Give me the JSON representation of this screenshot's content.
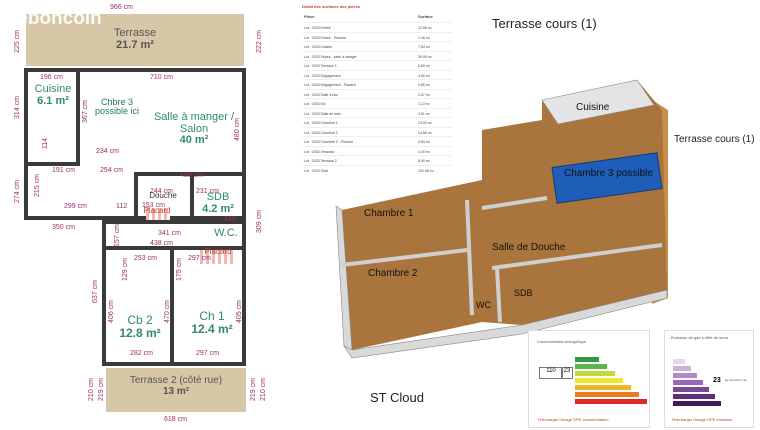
{
  "plan": {
    "watermark": "leboncoin",
    "terrace_top": {
      "name": "Terrasse",
      "area": "21.7 m²"
    },
    "terrace_bottom": {
      "name": "Terrasse 2 (côté rue)",
      "area": "13 m²"
    },
    "kitchen": {
      "name": "Cuisine",
      "area": "6.1 m²"
    },
    "chbre3": {
      "text": "Chbre 3 possible ici"
    },
    "living": {
      "name": "Salle à manger / Salon",
      "area": "40 m²"
    },
    "douche": {
      "name": "Douche",
      "area": "3 m²"
    },
    "sdb": {
      "name": "SDB",
      "area": "4.2 m²"
    },
    "placard1": {
      "name": "Placard",
      "area": "146"
    },
    "placard2": {
      "name": "Placard",
      "area": "179 cm"
    },
    "wc": {
      "name": "W.C."
    },
    "ch2": {
      "name": "Cb 2",
      "area": "12.8 m²"
    },
    "ch1": {
      "name": "Ch 1",
      "area": "12.4 m²"
    },
    "dims": {
      "top_width": "966 cm",
      "kitchen_w": "196 cm",
      "living_w": "710 cm",
      "d254": "254 cm",
      "d234": "234 cm",
      "d191": "191 cm",
      "d489": "489 cm",
      "d299": "299 cm",
      "d244": "244 cm",
      "d231": "231 cm",
      "d112": "112",
      "d153": "153 cm",
      "d142": "142",
      "d341": "341 cm",
      "d350": "350 cm",
      "d438": "438 cm",
      "d253": "253 cm",
      "d282": "282 cm",
      "d297a": "297 cm",
      "d297b": "297 cm",
      "d618": "618 cm",
      "v225": "225 cm",
      "v314": "314 cm",
      "v274": "274 cm",
      "v215": "215 cm",
      "v114": "114",
      "v367": "367 cm",
      "v480": "480 cm",
      "v222": "222 cm",
      "v309": "309 cm",
      "v637": "637 cm",
      "v157": "157 cm",
      "v406": "406 cm",
      "v470": "470 cm",
      "v405": "405 cm",
      "v219a": "219 cm",
      "v219b": "219 cm",
      "v210a": "210 cm",
      "v210b": "210 cm",
      "v129": "129 cm",
      "v175": "175 cm"
    }
  },
  "table": {
    "title": "Détail des surfaces des pièces",
    "header": [
      "Pièce",
      "Surface"
    ],
    "rows": [
      [
        "Lot : 2033 Entrée",
        "12.58 m²"
      ],
      [
        "Lot : 2033 Entrée - Placard",
        "1.46 m²"
      ],
      [
        "Lot : 2033 Cuisine",
        "7.84 m²"
      ],
      [
        "Lot : 2033 Séjour - salle à manger",
        "39.99 m²"
      ],
      [
        "Lot : 2033 Terrasse 1",
        "6.60 m²"
      ],
      [
        "Lot : 2033 Dégagement",
        "4.60 m²"
      ],
      [
        "Lot : 2033 Dégagement - Placard",
        "0.85 m²"
      ],
      [
        "Lot : 2033 Salle d'eau",
        "2.57 m²"
      ],
      [
        "Lot : 2033 Wc",
        "1.13 m²"
      ],
      [
        "Lot : 2033 Salle de bain",
        "3.81 m²"
      ],
      [
        "Lot : 2033 Chambre 1",
        "13.03 m²"
      ],
      [
        "Lot : 2033 Chambre 2",
        "13.66 m²"
      ],
      [
        "Lot : 2033 Chambre 2 - Placard",
        "0.84 m²"
      ],
      [
        "Lot : 2033 Véranda",
        "3.39 m²"
      ],
      [
        "Lot : 2033 Terrasse 2",
        "8.90 m²"
      ],
      [
        "Lot : 2033 Total",
        "102.98 m²"
      ]
    ]
  },
  "view3d": {
    "title": "Terrasse cours (1)",
    "terrace_label": "Terrasse cours (1)",
    "cuisine": "Cuisine",
    "chambre3": "Chambre 3 possible",
    "chambre1": "Chambre 1",
    "chambre2": "Chambre 2",
    "salle_douche": "Salle de Douche",
    "sdb": "SDB",
    "wc": "WC",
    "city": "ST Cloud"
  },
  "energy": {
    "title": "Consommation énergétique",
    "val1": "110",
    "val2": "23",
    "link": "Télécharger l'image DPE consommation",
    "colors": [
      "#2e9a4a",
      "#5bb548",
      "#c6d83a",
      "#f2e52a",
      "#f0b32a",
      "#e97a22",
      "#d92d23"
    ]
  },
  "ges": {
    "title": "Émission de gaz à effet de serre",
    "value": "23",
    "unit": "kg éqCO2/m².an",
    "link": "Télécharger l'image DPE emission",
    "colors": [
      "#e6d6ee",
      "#cdb0dc",
      "#b38ac9",
      "#9b66b5",
      "#7d469b",
      "#5f2e7c",
      "#3f1a5b"
    ]
  }
}
